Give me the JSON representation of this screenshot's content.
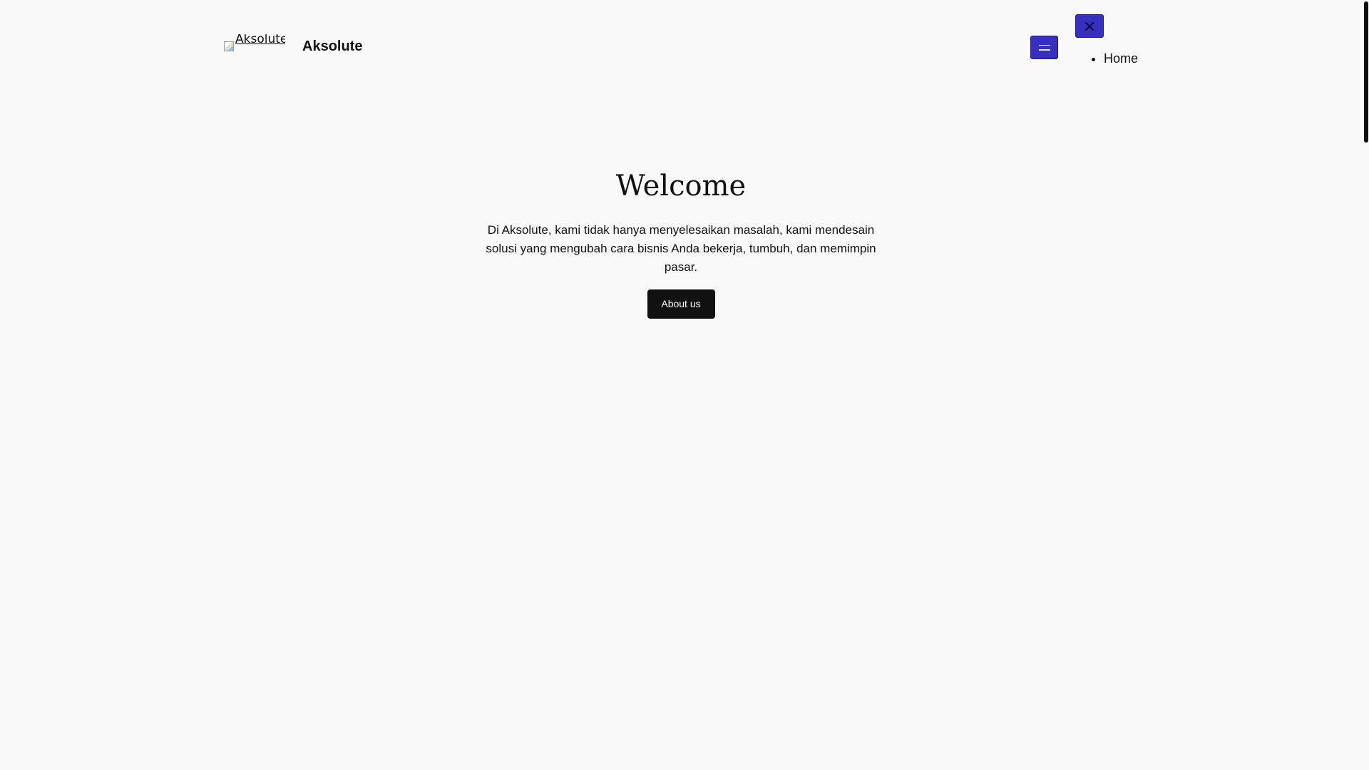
{
  "header": {
    "logo_alt": "Aksolute",
    "site_title": "Aksolute",
    "menu_open_label": "Open menu",
    "menu_close_label": "Close menu",
    "nav_items": [
      {
        "label": "Home"
      }
    ]
  },
  "hero": {
    "title": "Welcome",
    "description": "Di Aksolute, kami tidak hanya menyelesaikan masalah, kami mendesain solusi yang mengubah cara bisnis Anda bekerja, tumbuh, dan memimpin pasar.",
    "button_label": "About us"
  },
  "colors": {
    "background": "#f9f9f9",
    "menu_button": "#3530c0",
    "primary_button": "#111111",
    "text": "#111111"
  },
  "icons": {
    "menu_open": "hamburger-icon",
    "menu_close": "close-icon",
    "logo": "broken-image-icon"
  }
}
